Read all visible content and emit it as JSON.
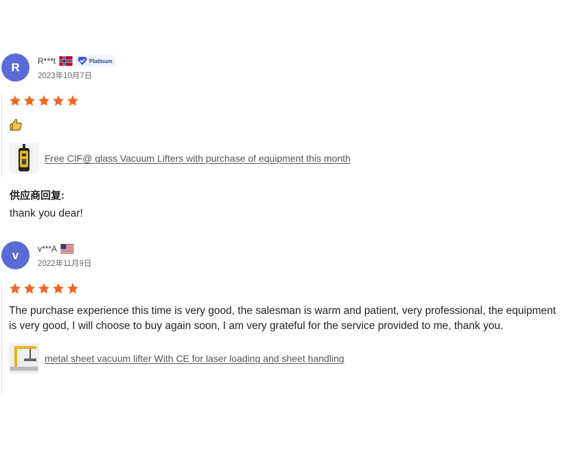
{
  "reviews": [
    {
      "avatar_letter": "R",
      "user": "R***t",
      "country_flag": "norway-flag-icon",
      "badge": "Platinum",
      "date": "2023年10月7日",
      "rating": 5,
      "emoji_icon": "thumbs-up-icon",
      "product_title": "Free CIF@ glass Vacuum Lifters with purchase of equipment this month",
      "reply_title": "供应商回复:",
      "reply_text": "thank you dear!"
    },
    {
      "avatar_letter": "v",
      "user": "v***A",
      "country_flag": "usa-flag-icon",
      "date": "2022年11月9日",
      "rating": 5,
      "text": "The purchase experience this time is very good, the salesman is warm and patient, very professional, the equipment is very good, I will choose to buy again soon, I am very grateful for the service provided to me, thank you.",
      "product_title": "metal sheet vacuum lifter With CE for laser loading and sheet handling"
    }
  ],
  "colors": {
    "avatar": "#5b6bd6",
    "star": "#f26522",
    "link": "#555555"
  }
}
